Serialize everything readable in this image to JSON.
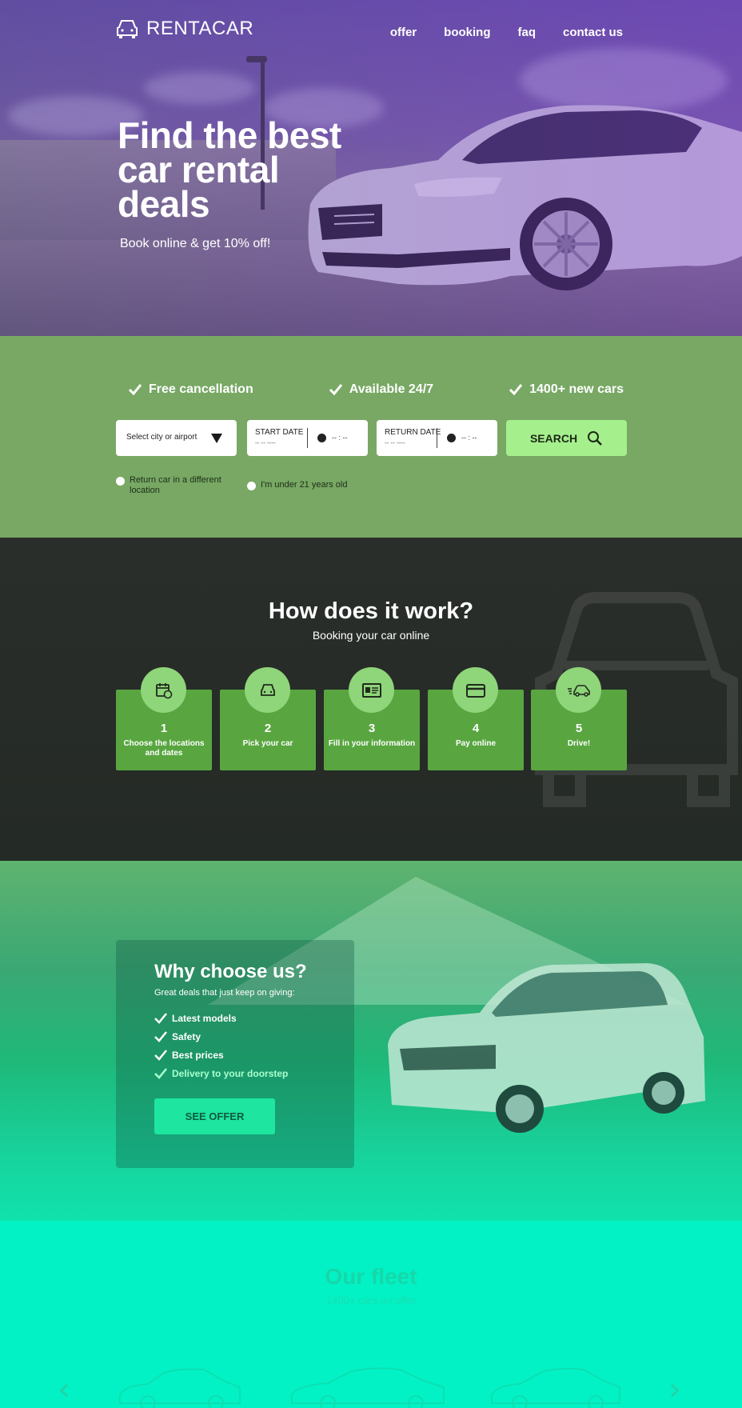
{
  "brand": {
    "name": "RENTACAR"
  },
  "nav": {
    "items": [
      "offer",
      "booking",
      "faq",
      "contact us"
    ]
  },
  "hero": {
    "title_lines": [
      "Find the best",
      "car rental",
      "deals"
    ],
    "subtitle": "Book online & get 10% off!"
  },
  "features": [
    "Free cancellation",
    "Available 24/7",
    "1400+ new cars"
  ],
  "search": {
    "city_placeholder": "Select city or airport",
    "start_label": "START DATE",
    "start_value": "-- -- ----",
    "start_time": "-- : --",
    "return_label": "RETURN DATE",
    "return_value": "-- -- ----",
    "return_time": "-- : --",
    "button": "SEARCH",
    "options": [
      "Return car in a different location",
      "I'm under 21 years old"
    ]
  },
  "how": {
    "title": "How does it work?",
    "subtitle": "Booking your car online",
    "steps": [
      {
        "num": "1",
        "text": "Choose the locations and dates",
        "icon": "calendar-icon"
      },
      {
        "num": "2",
        "text": "Pick your car",
        "icon": "car-icon"
      },
      {
        "num": "3",
        "text": "Fill in your information",
        "icon": "id-card-icon"
      },
      {
        "num": "4",
        "text": "Pay online",
        "icon": "credit-card-icon"
      },
      {
        "num": "5",
        "text": "Drive!",
        "icon": "moving-car-icon"
      }
    ]
  },
  "why": {
    "title": "Why choose us?",
    "subtitle": "Great deals that just keep on giving:",
    "items": [
      "Latest models",
      "Safety",
      "Best prices",
      "Delivery to your doorstep"
    ],
    "button": "SEE OFFER"
  },
  "fleet": {
    "title": "Our fleet",
    "subtitle": "1400+ cars on offer"
  },
  "colors": {
    "hero_tint": "#6c5aa8",
    "search_bg": "#78a864",
    "step_green": "#59a640",
    "search_button": "#a6ef8d",
    "fleet_bg": "#02f2c5"
  }
}
